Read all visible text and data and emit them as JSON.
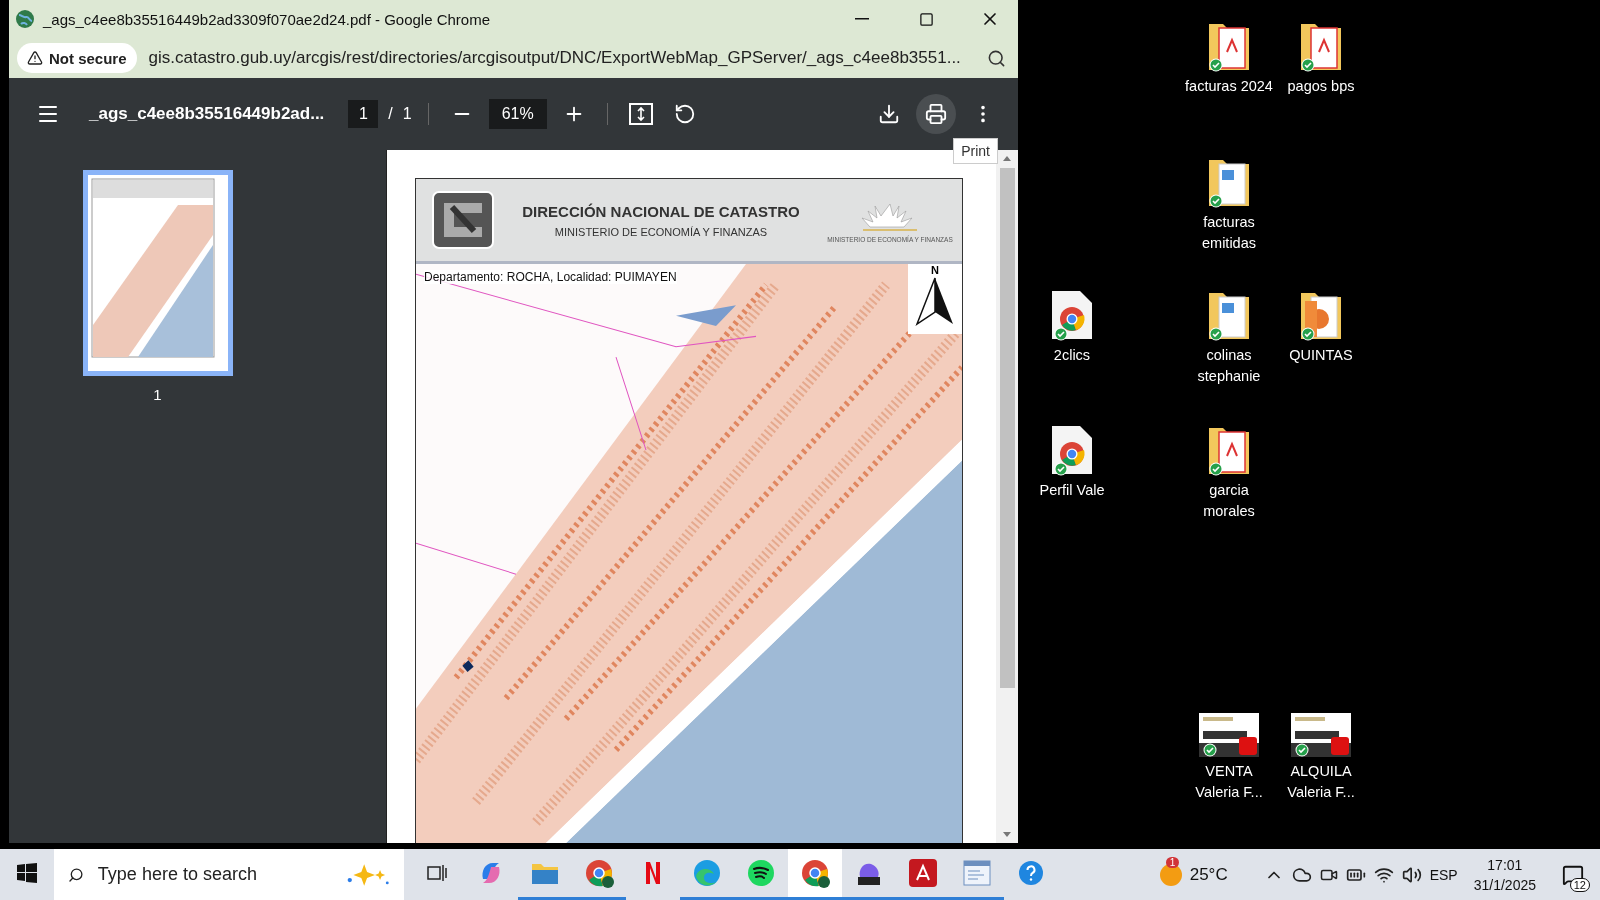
{
  "window": {
    "title": "_ags_c4ee8b35516449b2ad3309f070ae2d24.pdf - Google Chrome"
  },
  "address_bar": {
    "security": "Not secure",
    "url": "gis.catastro.gub.uy/arcgis/rest/directories/arcgisoutput/DNC/ExportWebMap_GPServer/_ags_c4ee8b3551..."
  },
  "pdf_toolbar": {
    "filename": "_ags_c4ee8b35516449b2ad...",
    "page": "1",
    "page_separator": "/",
    "page_count": "1",
    "zoom": "61%",
    "tooltip": "Print"
  },
  "thumbnails": [
    {
      "label": "1",
      "selected": true
    }
  ],
  "document": {
    "header_title": "DIRECCIÓN NACIONAL DE CATASTRO",
    "header_subtitle": "MINISTERIO DE ECONOMÍA Y FINANZAS",
    "emblem_caption": "MINISTERIO DE ECONOMÍA Y FINANZAS",
    "location": "Departamento: ROCHA, Localidad: PUIMAYEN",
    "north": "N"
  },
  "desktop_icons": [
    {
      "label": "facturas 2024",
      "kind": "folder-pdf",
      "synced": true
    },
    {
      "label": "pagos bps",
      "kind": "folder-pdf",
      "synced": true
    },
    {
      "label": "facturas emitidas",
      "kind": "folder-doc",
      "synced": true
    },
    {
      "label": "2clics",
      "kind": "chrome-file",
      "synced": true
    },
    {
      "label": "colinas stephanie",
      "kind": "folder-doc",
      "synced": true
    },
    {
      "label": "QUINTAS",
      "kind": "folder-ppt",
      "synced": true
    },
    {
      "label": "Perfil Vale",
      "kind": "chrome-file",
      "synced": true
    },
    {
      "label": "garcia morales",
      "kind": "folder-pdf",
      "synced": true
    },
    {
      "label": "VENTA Valeria F...",
      "kind": "pdf-thumb",
      "synced": true
    },
    {
      "label": "ALQUILA Valeria F...",
      "kind": "pdf-thumb",
      "synced": true
    }
  ],
  "taskbar": {
    "search": {
      "placeholder": "Type here to search"
    },
    "apps": [
      {
        "kind": "taskview",
        "running": false,
        "selected": false
      },
      {
        "kind": "copilot",
        "running": false,
        "selected": false
      },
      {
        "kind": "explorer",
        "running": true,
        "selected": false
      },
      {
        "kind": "chrome",
        "running": true,
        "selected": false
      },
      {
        "kind": "netflix",
        "running": false,
        "selected": false
      },
      {
        "kind": "edge",
        "running": true,
        "selected": false
      },
      {
        "kind": "spotify",
        "running": true,
        "selected": false
      },
      {
        "kind": "chrome",
        "running": true,
        "selected": true
      },
      {
        "kind": "m365",
        "running": true,
        "selected": false
      },
      {
        "kind": "acrobat",
        "running": true,
        "selected": false
      },
      {
        "kind": "notepad",
        "running": true,
        "selected": false
      },
      {
        "kind": "help",
        "running": false,
        "selected": false
      }
    ],
    "weather": {
      "temperature": "25°C",
      "badge": "1"
    },
    "language": "ESP",
    "time": "17:01",
    "date": "31/1/2025",
    "notifications": "12"
  }
}
